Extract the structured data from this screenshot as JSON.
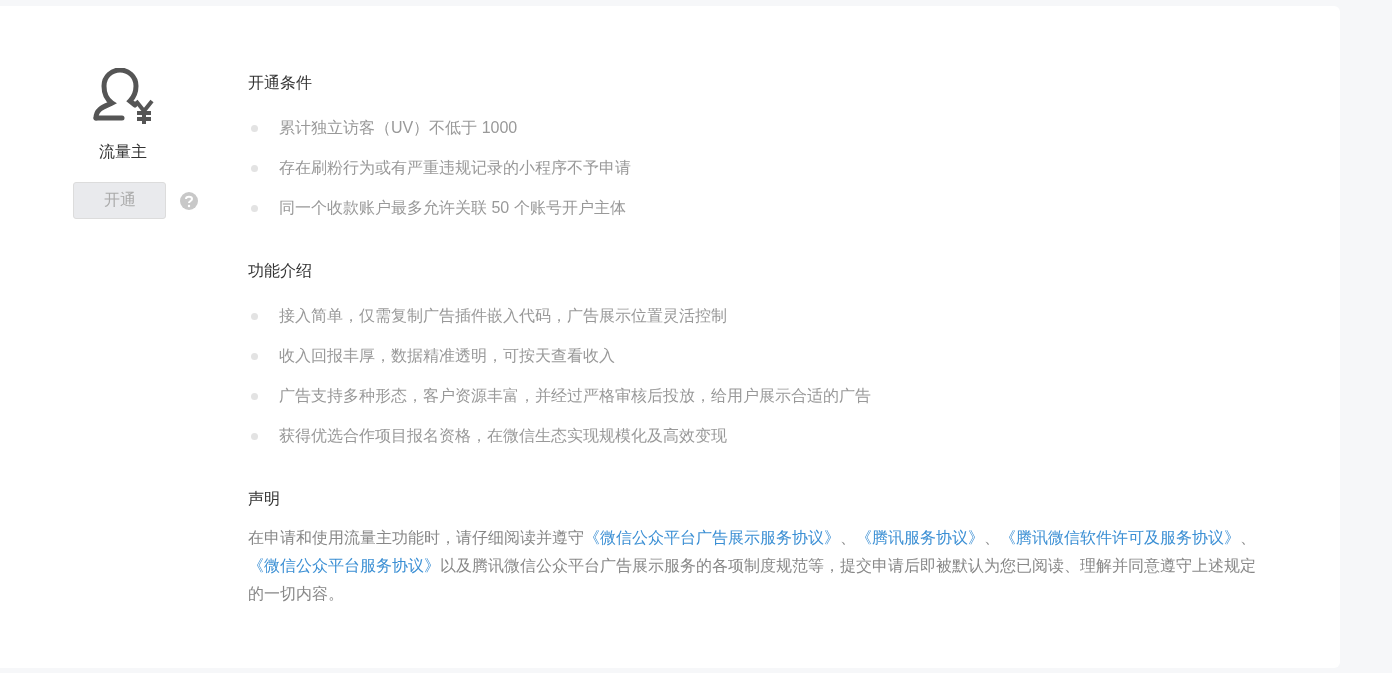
{
  "feature": {
    "name": "流量主",
    "button": {
      "label": "开通",
      "disabled": true
    }
  },
  "sections": [
    {
      "title": "开通条件",
      "items": [
        "累计独立访客（UV）不低于 1000",
        "存在刷粉行为或有严重违规记录的小程序不予申请",
        "同一个收款账户最多允许关联 50 个账号开户主体"
      ]
    },
    {
      "title": "功能介绍",
      "items": [
        "接入简单，仅需复制广告插件嵌入代码，广告展示位置灵活控制",
        "收入回报丰厚，数据精准透明，可按天查看收入",
        "广告支持多种形态，客户资源丰富，并经过严格审核后投放，给用户展示合适的广告",
        "获得优选合作项目报名资格，在微信生态实现规模化及高效变现"
      ]
    }
  ],
  "statement": {
    "title": "声明",
    "parts": [
      {
        "kind": "text",
        "text": "在申请和使用流量主功能时，请仔细阅读并遵守"
      },
      {
        "kind": "link",
        "text": "《微信公众平台广告展示服务协议》"
      },
      {
        "kind": "text",
        "text": "、"
      },
      {
        "kind": "link",
        "text": "《腾讯服务协议》"
      },
      {
        "kind": "text",
        "text": "、"
      },
      {
        "kind": "link",
        "text": "《腾讯微信软件许可及服务协议》"
      },
      {
        "kind": "text",
        "text": "、"
      },
      {
        "kind": "link",
        "text": "《微信公众平台服务协议》"
      },
      {
        "kind": "text",
        "text": "以及腾讯微信公众平台广告展示服务的各项制度规范等，提交申请后即被默认为您已阅读、理解并同意遵守上述规定的一切内容。"
      }
    ]
  }
}
